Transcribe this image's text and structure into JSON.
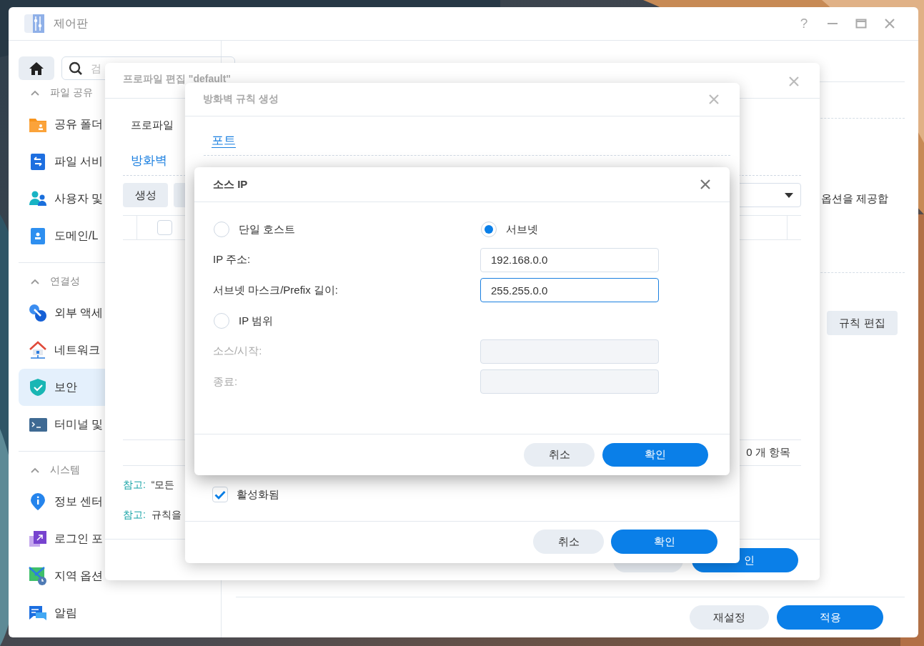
{
  "window": {
    "title": "제어판",
    "help": "?"
  },
  "sidebar": {
    "search_placeholder": "검",
    "sections": [
      {
        "title": "파일 공유",
        "expanded": true,
        "items": [
          {
            "label": "공유 폴더",
            "kind": "folder",
            "selected": false
          },
          {
            "label": "파일 서비",
            "kind": "fileservice",
            "selected": false
          },
          {
            "label": "사용자 및",
            "kind": "users",
            "selected": false
          },
          {
            "label": "도메인/L",
            "kind": "domain",
            "selected": false
          }
        ]
      },
      {
        "title": "연결성",
        "expanded": true,
        "items": [
          {
            "label": "외부 액세",
            "kind": "link",
            "selected": false
          },
          {
            "label": "네트워크",
            "kind": "network",
            "selected": false
          },
          {
            "label": "보안",
            "kind": "shield",
            "selected": true
          },
          {
            "label": "터미널 및",
            "kind": "terminal",
            "selected": false
          }
        ]
      },
      {
        "title": "시스템",
        "expanded": true,
        "items": [
          {
            "label": "정보 센터",
            "kind": "info",
            "selected": false
          },
          {
            "label": "로그인 포",
            "kind": "portal",
            "selected": false
          },
          {
            "label": "지역 옵션",
            "kind": "region",
            "selected": false
          },
          {
            "label": "알림",
            "kind": "chat",
            "selected": false
          }
        ]
      }
    ]
  },
  "content": {
    "option_text": "옵션을 제공합",
    "edit_rule_button": "규칙 편집",
    "buttons": [
      {
        "label": "재설정",
        "kind": "secondary"
      },
      {
        "label": "적용",
        "kind": "primary"
      }
    ]
  },
  "profile_dialog": {
    "title": "프로파일 편집 \"default\"",
    "profile_label": "프로파일",
    "section_title": "방화벽",
    "create_button": "생성",
    "select_all": {
      "checked": false
    },
    "item_count": "0 개 항목",
    "notes": [
      {
        "label": "참고:",
        "text": "“모든"
      },
      {
        "label": "참고:",
        "text": "규칙을"
      }
    ],
    "confirm_label": "인"
  },
  "rule_dialog": {
    "title": "방화벽 규칙 생성",
    "tab": "포트",
    "enabled": {
      "label": "활성화됨",
      "checked": true
    },
    "buttons": [
      {
        "label": "취소",
        "kind": "secondary"
      },
      {
        "label": "확인",
        "kind": "primary"
      }
    ]
  },
  "source_ip_dialog": {
    "title": "소스 IP",
    "options": [
      {
        "label": "단일 호스트",
        "selected": false
      },
      {
        "label": "서브넷",
        "selected": true
      },
      {
        "label": "IP 범위",
        "selected": false
      }
    ],
    "fields": [
      {
        "label": "IP 주소:",
        "value": "192.168.0.0",
        "disabled": false,
        "focused": false
      },
      {
        "label": "서브넷 마스크/Prefix 길이:",
        "value": "255.255.0.0",
        "disabled": false,
        "focused": true
      },
      {
        "label": "소스/시작:",
        "disabled": true,
        "focused": false
      },
      {
        "label": "종료:",
        "disabled": true,
        "focused": false
      }
    ],
    "buttons": [
      {
        "label": "취소",
        "kind": "secondary"
      },
      {
        "label": "확인",
        "kind": "primary"
      }
    ]
  }
}
